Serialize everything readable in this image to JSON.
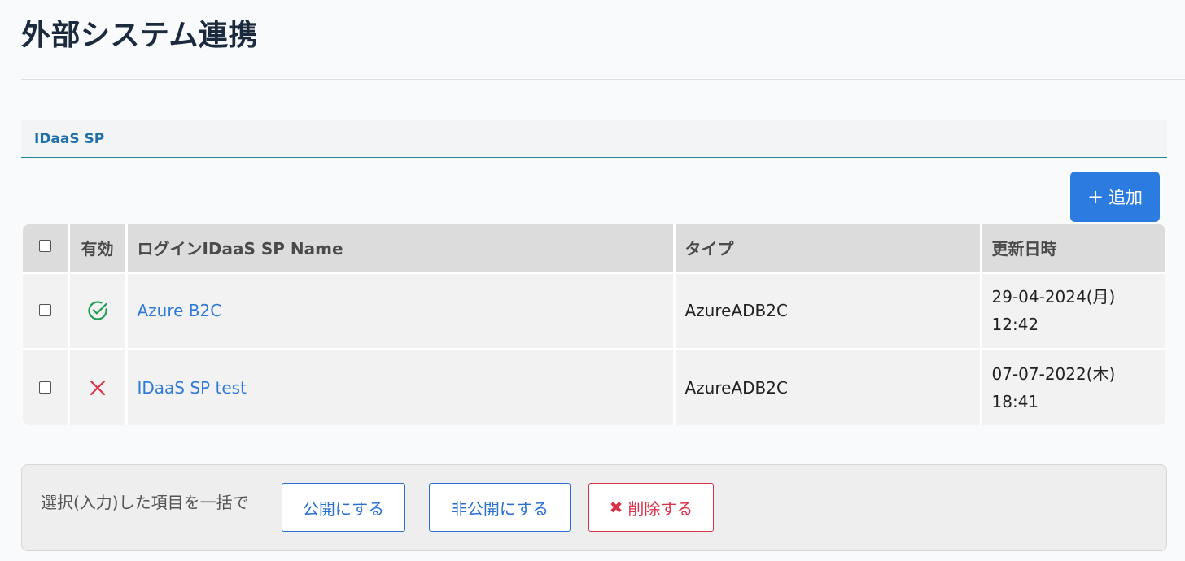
{
  "page": {
    "title": "外部システム連携"
  },
  "section": {
    "title": "IDaaS SP"
  },
  "toolbar": {
    "add_label": "追加",
    "add_icon": "plus-icon"
  },
  "table": {
    "headers": {
      "enabled": "有効",
      "name": "ログインIDaaS SP Name",
      "type": "タイプ",
      "updated": "更新日時"
    },
    "rows": [
      {
        "enabled": true,
        "status_icon": "check-circle-icon",
        "status_color": "#1f9d55",
        "name": "Azure B2C",
        "type": "AzureADB2C",
        "updated_date": "29-04-2024(月)",
        "updated_time": "12:42"
      },
      {
        "enabled": false,
        "status_icon": "x-icon",
        "status_color": "#d6334a",
        "name": "IDaaS SP test",
        "type": "AzureADB2C",
        "updated_date": "07-07-2022(木)",
        "updated_time": "18:41"
      }
    ]
  },
  "bulk": {
    "label": "選択(入力)した項目を一括で",
    "publish_label": "公開にする",
    "unpublish_label": "非公開にする",
    "delete_label": "削除する",
    "delete_icon": "times-icon"
  },
  "colors": {
    "primary": "#2b7be0",
    "link": "#2f7ad7",
    "danger": "#d6334a",
    "success": "#1f9d55",
    "section_accent": "#1a8a9a"
  }
}
